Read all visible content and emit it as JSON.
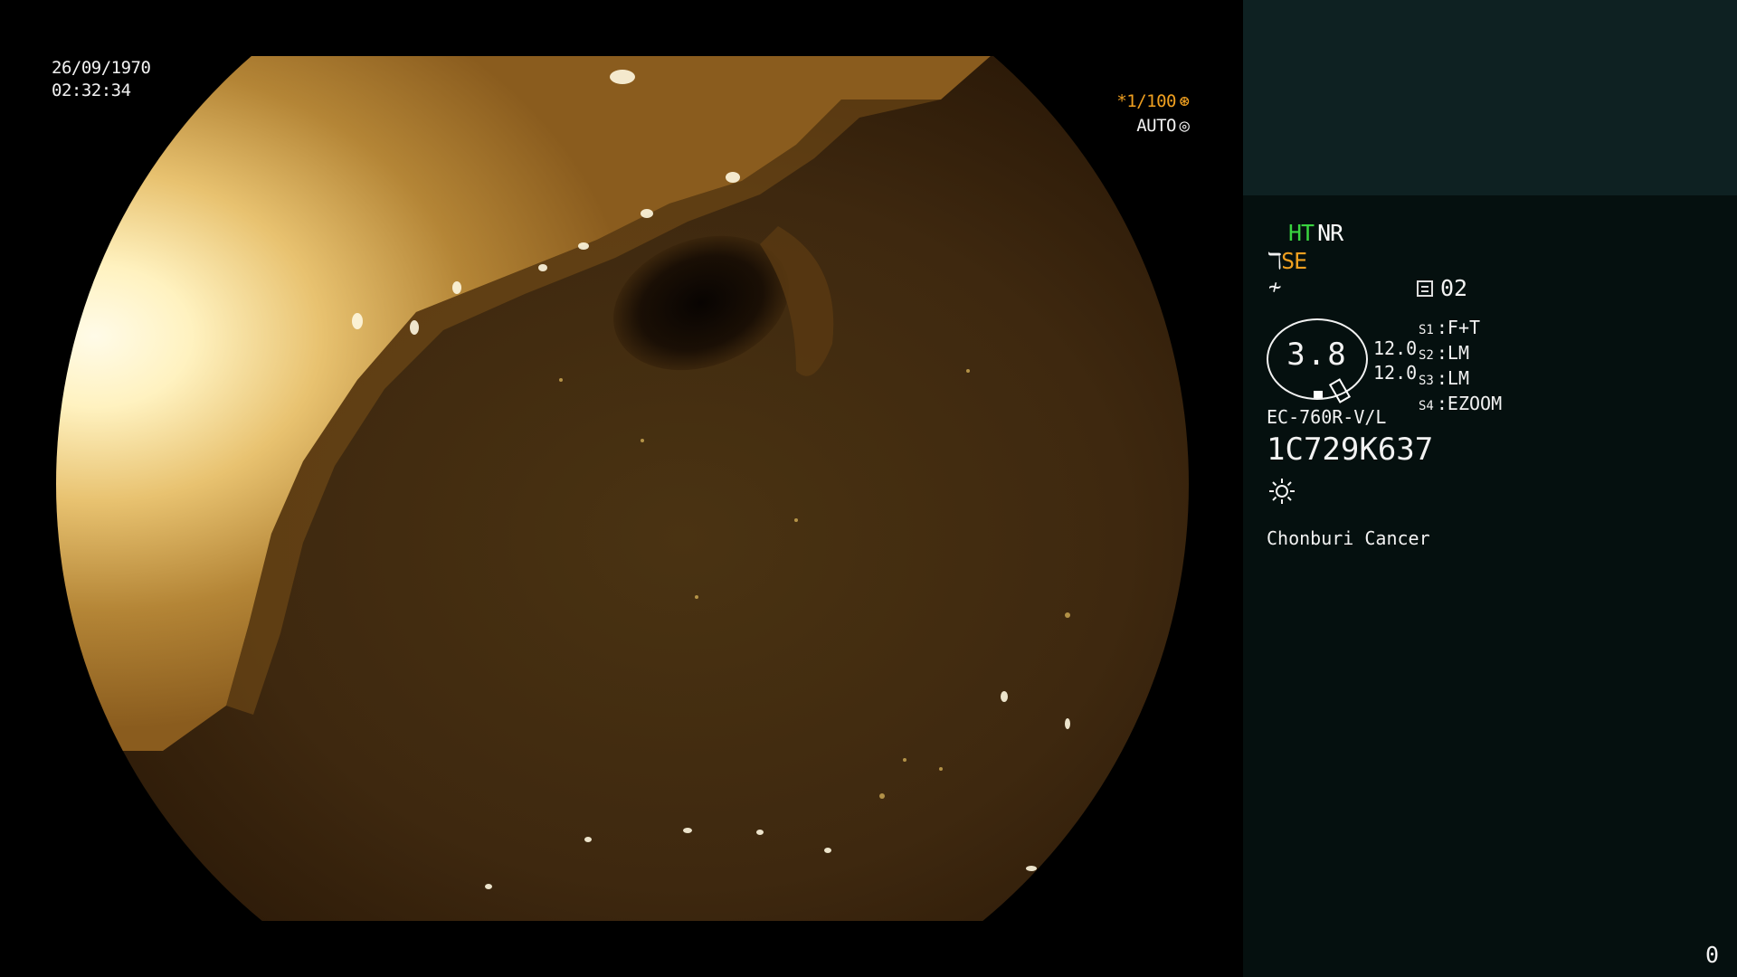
{
  "video": {
    "date": "26/09/1970",
    "time": "02:32:34",
    "shutter": "*1/100",
    "shutter_icon": "shutter-icon",
    "iris_mode": "AUTO",
    "iris_icon": "iris-icon"
  },
  "panel": {
    "modes": {
      "ht": "HT",
      "nr": "NR",
      "se": "SE"
    },
    "memory": "02",
    "gauge": {
      "value": "3.8",
      "upper": "12.0",
      "lower": "12.0"
    },
    "settings": [
      {
        "key": "S1",
        "value": "F+T"
      },
      {
        "key": "S2",
        "value": "LM"
      },
      {
        "key": "S3",
        "value": "LM"
      },
      {
        "key": "S4",
        "value": "EZOOM"
      }
    ],
    "scope_model": "EC-760R-V/L",
    "serial_number": "1C729K637",
    "hospital": "Chonburi Cancer",
    "frame_counter": "0"
  },
  "colors": {
    "ht": "#39d43f",
    "se": "#f0a020",
    "shutter": "#f0a020",
    "panel_bg": "#05100f",
    "panel_top_bg": "#0e2122"
  },
  "icons": [
    "scope-angle-icon",
    "scope-curve-icon",
    "memory-icon",
    "light-source-icon"
  ]
}
